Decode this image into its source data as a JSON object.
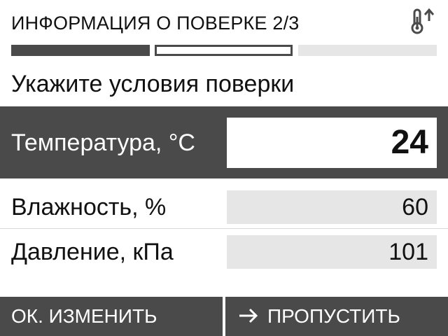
{
  "header": {
    "title": "ИНФОРМАЦИЯ О ПОВЕРКЕ 2/3",
    "icon": "thermometer-up-icon"
  },
  "progress": {
    "total_steps": 3,
    "current_step": 2
  },
  "prompt": "Укажите условия поверки",
  "fields": {
    "temperature": {
      "label": "Температура, °C",
      "value": "24"
    },
    "humidity": {
      "label": "Влажность, %",
      "value": "60"
    },
    "pressure": {
      "label": "Давление, кПа",
      "value": "101"
    }
  },
  "softkeys": {
    "left_label": "ОК. ИЗМЕНИТЬ",
    "right_label": "ПРОПУСТИТЬ",
    "right_icon": "arrow-right-icon"
  },
  "colors": {
    "dark": "#4a4a4a",
    "light": "#e6e6e6",
    "background": "#ffffff"
  }
}
